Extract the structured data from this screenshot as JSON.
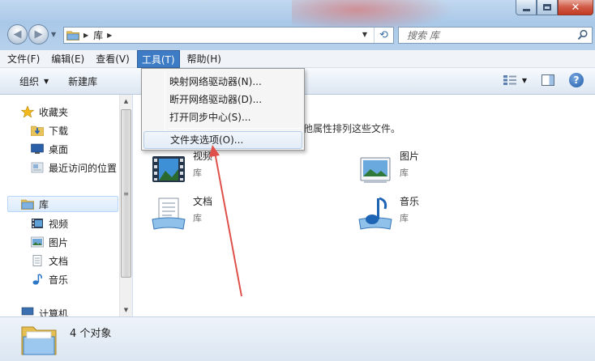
{
  "window": {
    "minimize_label": "",
    "maximize_label": "",
    "close_glyph": "✕"
  },
  "nav": {
    "back_glyph": "◀",
    "forward_glyph": "▶",
    "history_glyph": "▼"
  },
  "address": {
    "path": "库",
    "separator": "▶",
    "dropdown_glyph": "▼",
    "refresh_glyph": "⟲"
  },
  "search": {
    "placeholder": "搜索 库"
  },
  "menubar": {
    "items": [
      "文件(F)",
      "编辑(E)",
      "查看(V)",
      "工具(T)",
      "帮助(H)"
    ],
    "active_index": 3
  },
  "toolbar": {
    "organize_label": "组织",
    "new_library_label": "新建库",
    "help_glyph": "?"
  },
  "sidebar": {
    "favorites_label": "收藏夹",
    "favorites_items": [
      "下载",
      "桌面",
      "最近访问的位置"
    ],
    "libraries_label": "库",
    "libraries_items": [
      "视频",
      "图片",
      "文档",
      "音乐"
    ],
    "computer_label": "计算机",
    "scroll_up": "▲",
    "scroll_down": "▼",
    "scroll_grip": "≡"
  },
  "content": {
    "description_partial": "期和其他属性排列这些文件。",
    "libraries": [
      {
        "name": "视频",
        "type": "库",
        "icon": "video-library-icon"
      },
      {
        "name": "图片",
        "type": "库",
        "icon": "pictures-library-icon"
      },
      {
        "name": "文档",
        "type": "库",
        "icon": "documents-library-icon"
      },
      {
        "name": "音乐",
        "type": "库",
        "icon": "music-library-icon"
      }
    ]
  },
  "tools_menu": {
    "items": [
      "映射网络驱动器(N)...",
      "断开网络驱动器(D)...",
      "打开同步中心(S)...",
      "文件夹选项(O)..."
    ],
    "highlighted_index": 3
  },
  "status": {
    "count_text": "4 个对象"
  },
  "colors": {
    "accent": "#3d7cc4",
    "annotation_arrow": "#e0504a"
  }
}
